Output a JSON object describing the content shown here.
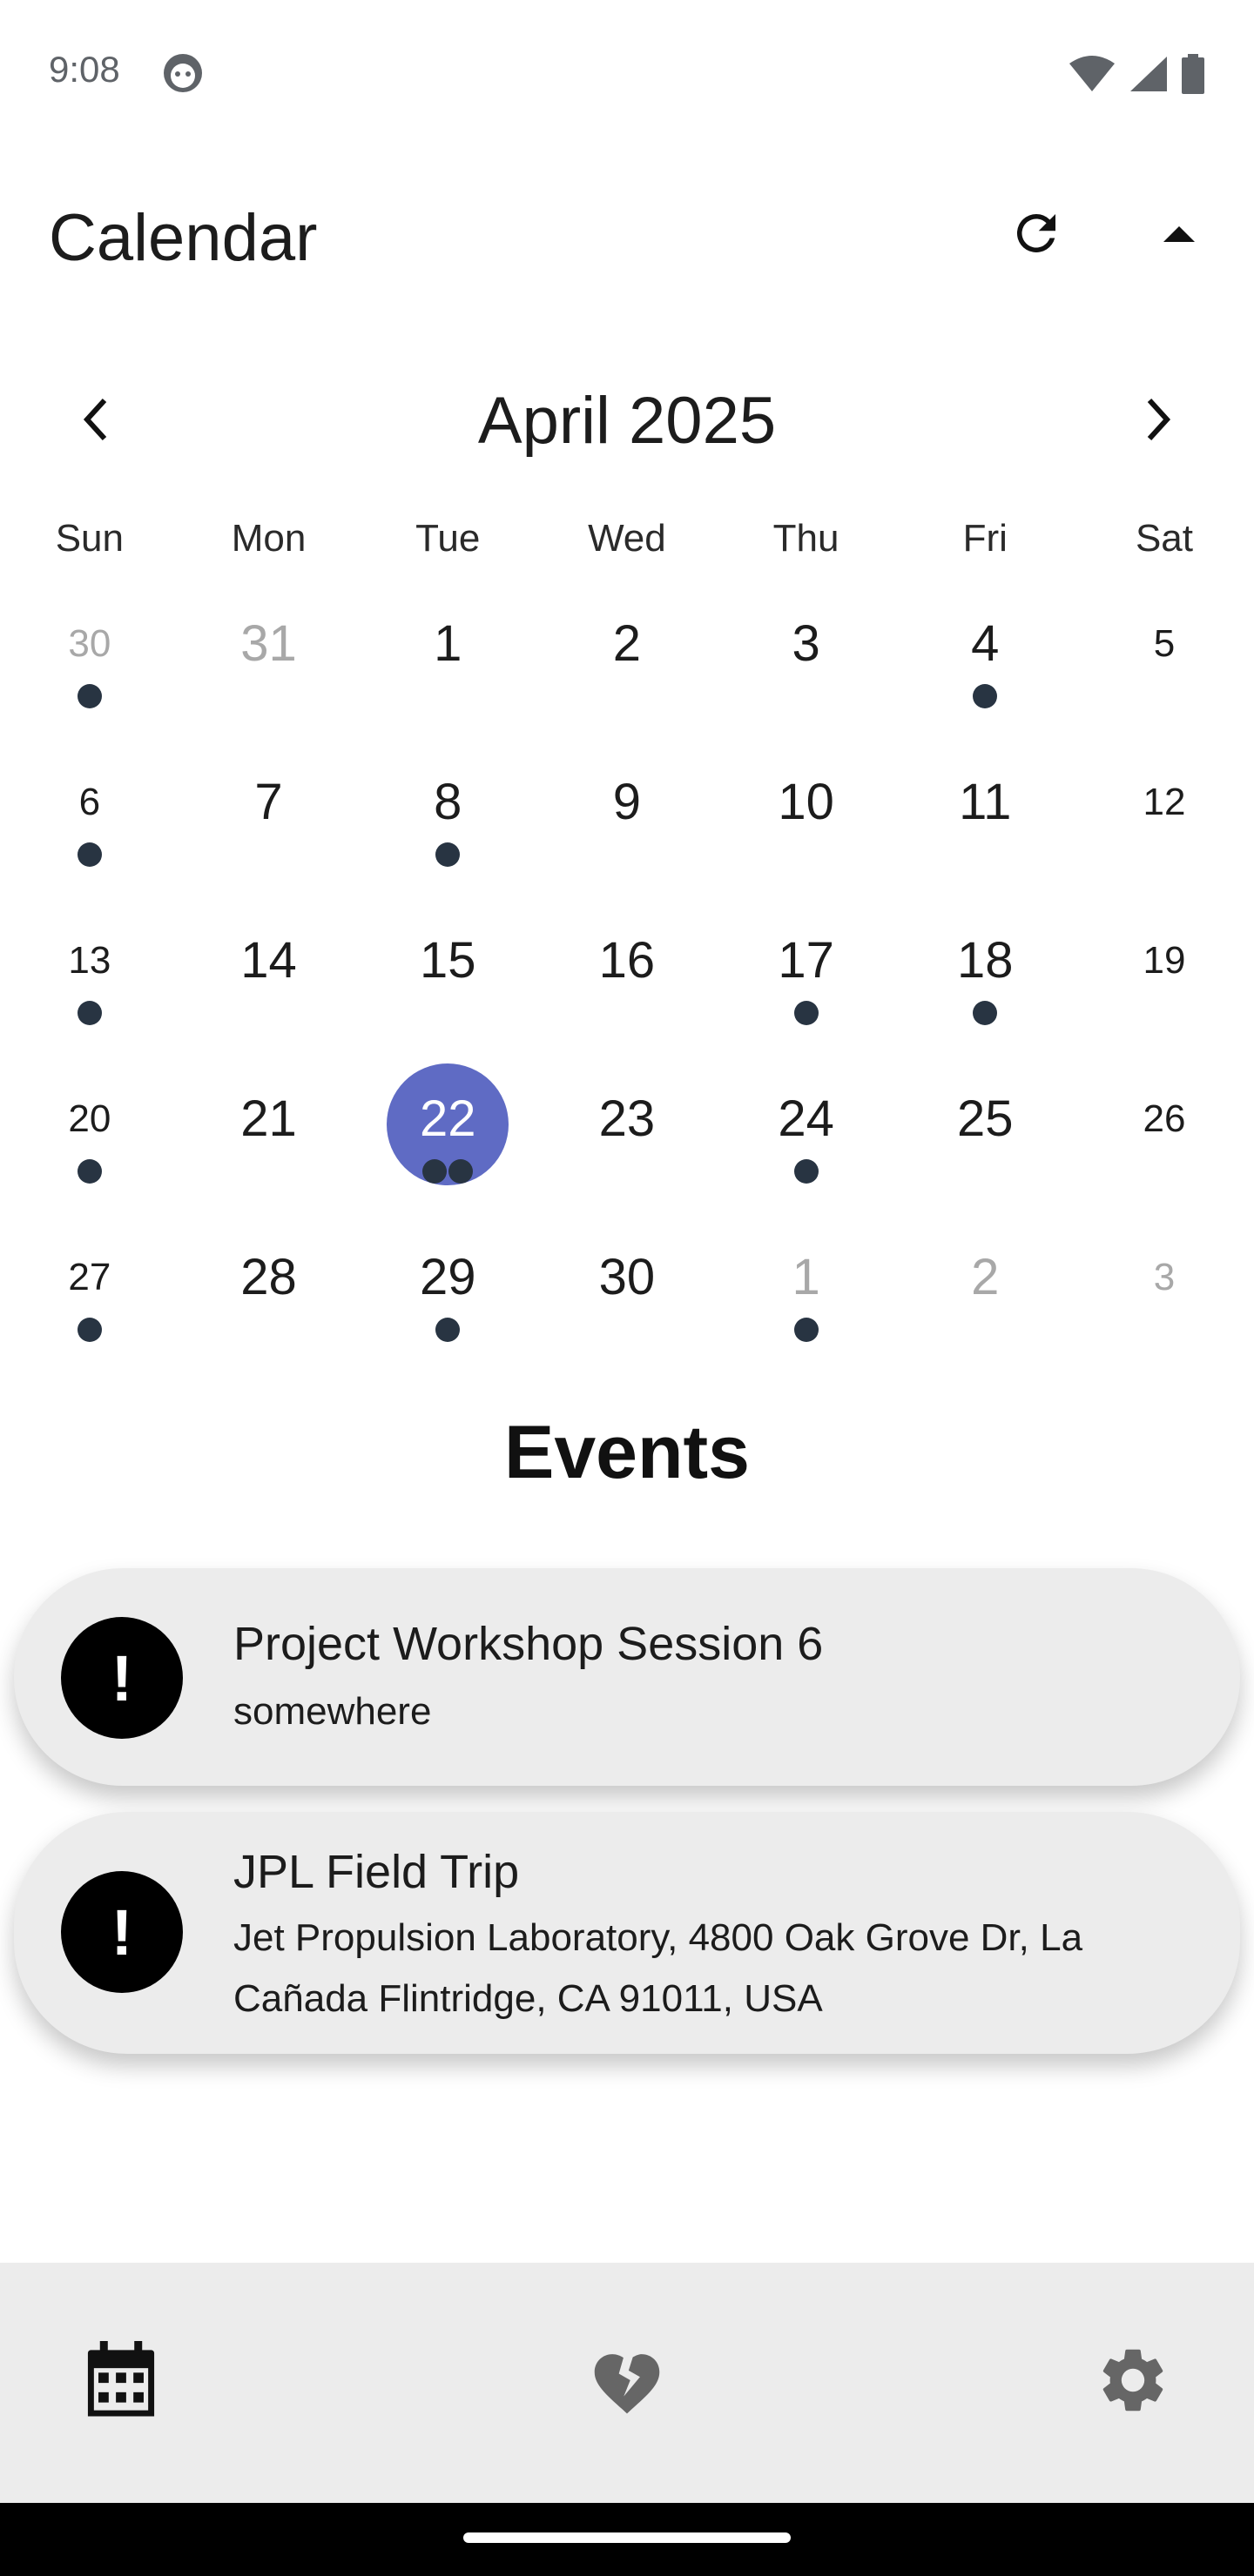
{
  "status_bar": {
    "time": "9:08"
  },
  "app_bar": {
    "title": "Calendar"
  },
  "calendar": {
    "month_title": "April 2025",
    "weekdays": [
      "Sun",
      "Mon",
      "Tue",
      "Wed",
      "Thu",
      "Fri",
      "Sat"
    ],
    "weeks": [
      [
        {
          "day": "30",
          "muted": true,
          "dots": 1
        },
        {
          "day": "31",
          "muted": true,
          "dots": 0
        },
        {
          "day": "1",
          "dots": 0
        },
        {
          "day": "2",
          "dots": 0
        },
        {
          "day": "3",
          "dots": 0
        },
        {
          "day": "4",
          "dots": 1
        },
        {
          "day": "5",
          "dots": 0
        }
      ],
      [
        {
          "day": "6",
          "dots": 1
        },
        {
          "day": "7",
          "dots": 0
        },
        {
          "day": "8",
          "dots": 1
        },
        {
          "day": "9",
          "dots": 0
        },
        {
          "day": "10",
          "dots": 0
        },
        {
          "day": "11",
          "dots": 0
        },
        {
          "day": "12",
          "dots": 0
        }
      ],
      [
        {
          "day": "13",
          "dots": 1
        },
        {
          "day": "14",
          "dots": 0
        },
        {
          "day": "15",
          "dots": 0
        },
        {
          "day": "16",
          "dots": 0
        },
        {
          "day": "17",
          "dots": 1
        },
        {
          "day": "18",
          "dots": 1
        },
        {
          "day": "19",
          "dots": 0
        }
      ],
      [
        {
          "day": "20",
          "dots": 1
        },
        {
          "day": "21",
          "dots": 0
        },
        {
          "day": "22",
          "dots": 2,
          "selected": true
        },
        {
          "day": "23",
          "dots": 0
        },
        {
          "day": "24",
          "dots": 1
        },
        {
          "day": "25",
          "dots": 0
        },
        {
          "day": "26",
          "dots": 0
        }
      ],
      [
        {
          "day": "27",
          "dots": 1
        },
        {
          "day": "28",
          "dots": 0
        },
        {
          "day": "29",
          "dots": 1
        },
        {
          "day": "30",
          "dots": 0
        },
        {
          "day": "1",
          "muted": true,
          "dots": 1
        },
        {
          "day": "2",
          "muted": true,
          "dots": 0
        },
        {
          "day": "3",
          "muted": true,
          "dots": 0
        }
      ]
    ],
    "selected_color": "#5f6bc4",
    "dot_color": "#283442"
  },
  "events_section": {
    "title": "Events",
    "events": [
      {
        "icon": "!",
        "title": "Project Workshop Session 6",
        "location": "somewhere"
      },
      {
        "icon": "!",
        "title": "JPL Field Trip",
        "location": "Jet Propulsion Laboratory, 4800 Oak Grove Dr, La Cañada Flintridge, CA 91011, USA"
      }
    ]
  },
  "bottom_nav": {
    "items": [
      {
        "icon": "calendar-icon"
      },
      {
        "icon": "broken-heart-icon"
      },
      {
        "icon": "settings-gear-icon"
      }
    ]
  }
}
